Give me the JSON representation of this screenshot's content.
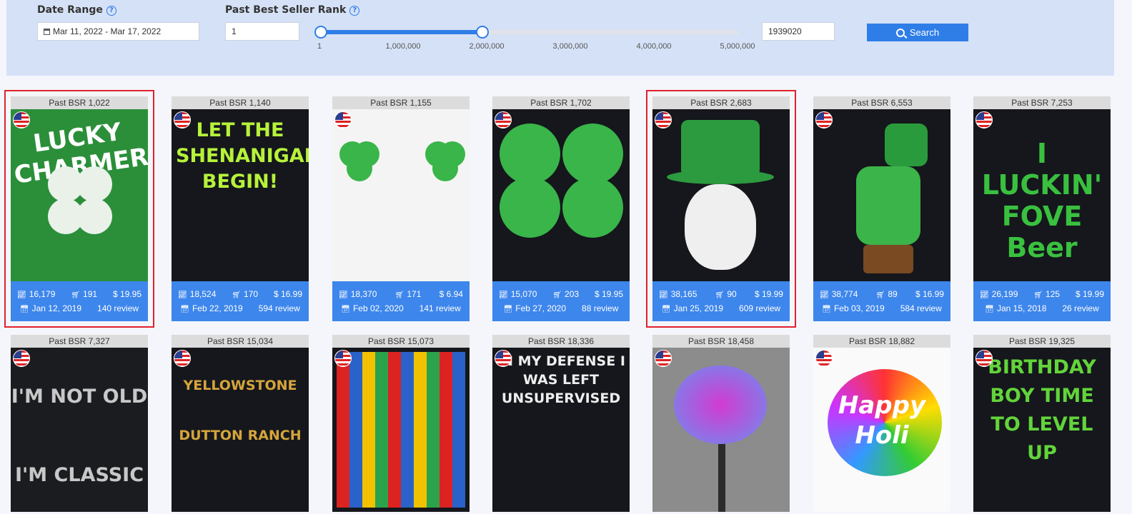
{
  "filters": {
    "date_range_label": "Date Range",
    "date_range_value": "Mar 11, 2022 - Mar 17, 2022",
    "bsr_label": "Past Best Seller Rank",
    "bsr_min": "1",
    "bsr_max": "1939020",
    "slider_ticks": [
      "1",
      "1,000,000",
      "2,000,000",
      "3,000,000",
      "4,000,000",
      "5,000,000"
    ],
    "slider_range": [
      1,
      1939020
    ],
    "search_label": "Search",
    "accent": "#2f7ee8"
  },
  "cards": [
    {
      "bsr": "Past BSR 1,022",
      "trend": "16,179",
      "sales": "191",
      "price": "$ 19.95",
      "date": "Jan 12, 2019",
      "reviews": "140 review",
      "selected": true,
      "art": "LUCKY CHARMER"
    },
    {
      "bsr": "Past BSR 1,140",
      "trend": "18,524",
      "sales": "170",
      "price": "$ 16.99",
      "date": "Feb 22, 2019",
      "reviews": "594 review",
      "selected": false,
      "art": "LET THE SHENANIGANS BEGIN!"
    },
    {
      "bsr": "Past BSR 1,155",
      "trend": "18,370",
      "sales": "171",
      "price": "$ 6.94",
      "date": "Feb 02, 2020",
      "reviews": "141 review",
      "selected": false,
      "art": ""
    },
    {
      "bsr": "Past BSR 1,702",
      "trend": "15,070",
      "sales": "203",
      "price": "$ 19.95",
      "date": "Feb 27, 2020",
      "reviews": "88 review",
      "selected": false,
      "art": ""
    },
    {
      "bsr": "Past BSR 2,683",
      "trend": "38,165",
      "sales": "90",
      "price": "$ 19.99",
      "date": "Jan 25, 2019",
      "reviews": "609 review",
      "selected": true,
      "art": ""
    },
    {
      "bsr": "Past BSR 6,553",
      "trend": "38,774",
      "sales": "89",
      "price": "$ 16.99",
      "date": "Feb 03, 2019",
      "reviews": "584 review",
      "selected": false,
      "art": ""
    },
    {
      "bsr": "Past BSR 7,253",
      "trend": "26,199",
      "sales": "125",
      "price": "$ 19.99",
      "date": "Jan 15, 2018",
      "reviews": "26 review",
      "selected": false,
      "art": "I LUCKIN' FOVE Beer"
    },
    {
      "bsr": "Past BSR 7,327",
      "art": "I'M NOT OLD I'M CLASSIC"
    },
    {
      "bsr": "Past BSR 15,034",
      "art": "YELLOWSTONE DUTTON RANCH"
    },
    {
      "bsr": "Past BSR 15,073",
      "art": ""
    },
    {
      "bsr": "Past BSR 18,336",
      "art": "IN MY DEFENSE I WAS LEFT UNSUPERVISED"
    },
    {
      "bsr": "Past BSR 18,458",
      "art": ""
    },
    {
      "bsr": "Past BSR 18,882",
      "art": "Happy Holi"
    },
    {
      "bsr": "Past BSR 19,325",
      "art": "BIRTHDAY BOY TIME TO LEVEL UP"
    }
  ],
  "icons": {
    "trend": "chart-icon",
    "sales": "cart-icon",
    "date": "calendar-icon",
    "flag": "us-flag-icon"
  }
}
